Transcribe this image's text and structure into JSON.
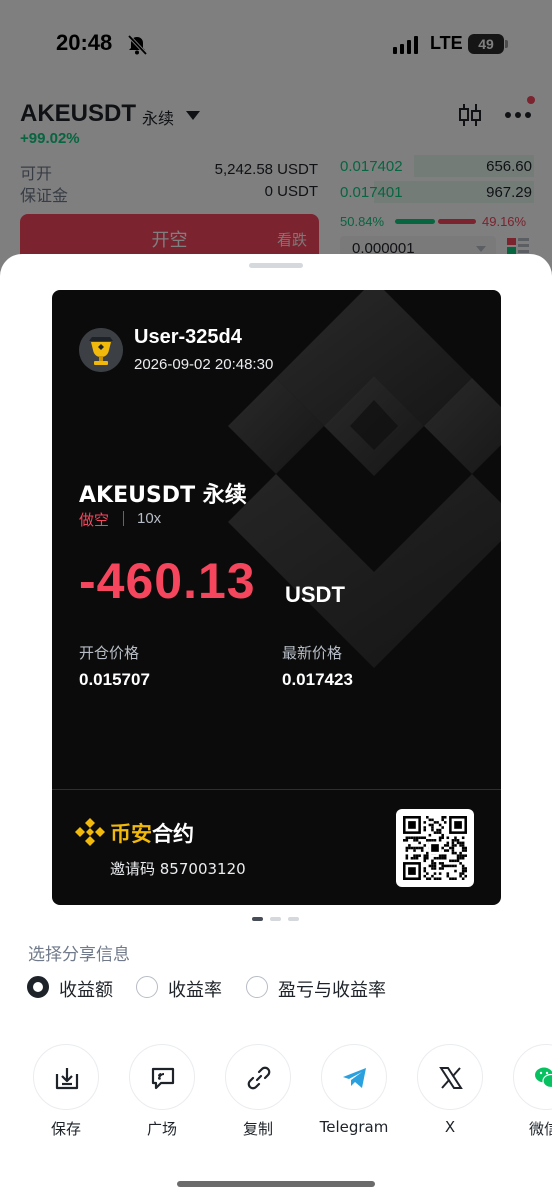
{
  "status_bar": {
    "time": "20:48",
    "network": "LTE",
    "battery": "49"
  },
  "background": {
    "pair_title": "AKEUSDT",
    "pair_type": "永续",
    "change": "+99.02%",
    "available_label": "可开",
    "available_value": "5,242.58 USDT",
    "margin_label": "保证金",
    "margin_value": "0 USDT",
    "order_book": [
      {
        "price": "0.017402",
        "qty": "656.60"
      },
      {
        "price": "0.017401",
        "qty": "967.29"
      }
    ],
    "ratio_buy": "50.84%",
    "ratio_sell": "49.16%",
    "open_short_label": "开空",
    "open_short_sub": "看跌",
    "step_value": "0.000001"
  },
  "card": {
    "username": "User-325d4",
    "timestamp": "2026-09-02 20:48:30",
    "pair": "AKEUSDT 永续",
    "side": "做空",
    "leverage": "10x",
    "pnl": "-460.13",
    "pnl_unit": "USDT",
    "entry_label": "开仓价格",
    "entry_value": "0.015707",
    "last_label": "最新价格",
    "last_value": "0.017423",
    "brand_yellow": "币安",
    "brand_white": "合约",
    "invite": "邀请码 857003120"
  },
  "pager": {
    "count": 3,
    "active": 1
  },
  "options": {
    "title": "选择分享信息",
    "items": [
      {
        "label": "收益额",
        "checked": true
      },
      {
        "label": "收益率",
        "checked": false
      },
      {
        "label": "盈亏与收益率",
        "checked": false
      }
    ]
  },
  "share_targets": [
    {
      "label": "保存",
      "icon": "save-icon"
    },
    {
      "label": "广场",
      "icon": "square-icon"
    },
    {
      "label": "复制",
      "icon": "link-icon"
    },
    {
      "label": "Telegram",
      "icon": "telegram-icon"
    },
    {
      "label": "X",
      "icon": "x-icon"
    },
    {
      "label": "微信",
      "icon": "wechat-icon"
    }
  ],
  "colors": {
    "up": "#0ecb81",
    "down": "#f6465d",
    "brand": "#f0b90b",
    "card_bg": "#0b0b0b"
  }
}
